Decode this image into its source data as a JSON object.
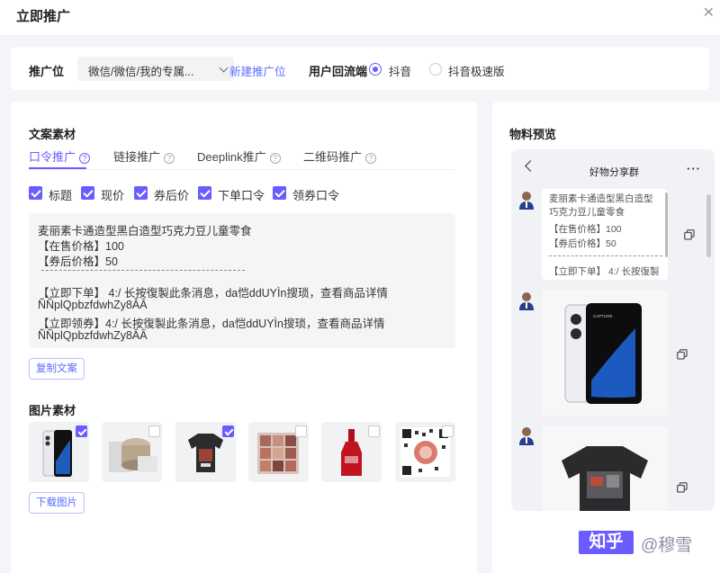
{
  "header": {
    "title": "立即推广",
    "close_icon": "close-icon"
  },
  "promo": {
    "label": "推广位",
    "select_value": "微信/微信/我的专属...",
    "new_link": "新建推广位",
    "return_label": "用户回流端",
    "options": [
      {
        "label": "抖音",
        "selected": true
      },
      {
        "label": "抖音极速版",
        "selected": false
      }
    ]
  },
  "copy": {
    "section_title": "文案素材",
    "tabs": [
      {
        "label": "口令推广",
        "active": true
      },
      {
        "label": "链接推广",
        "active": false
      },
      {
        "label": "Deeplink推广",
        "active": false
      },
      {
        "label": "二维码推广",
        "active": false
      }
    ],
    "checkboxes": [
      {
        "label": "标题",
        "checked": true
      },
      {
        "label": "现价",
        "checked": true
      },
      {
        "label": "券后价",
        "checked": true
      },
      {
        "label": "下单口令",
        "checked": true
      },
      {
        "label": "领券口令",
        "checked": true
      }
    ],
    "lines": [
      "麦丽素卡通造型黑白造型巧克力豆儿童零食",
      "【在售价格】100",
      "【券后价格】50",
      "【立即下单】 4:/ 长按復製此条消息，da恺ddUYÌn搜琐，查看商品详情",
      "ÑÑplQpbzfdwhZy8ÂÂ",
      "【立即领券】4:/ 长按復製此条消息，da恺ddUYÌn搜琐，查看商品详情",
      "ÑÑplQpbzfdwhZy8ÂÂ"
    ],
    "copy_button": "复制文案"
  },
  "images": {
    "section_title": "图片素材",
    "items": [
      {
        "name": "smartphone",
        "checked": true
      },
      {
        "name": "cosmetic-jar",
        "checked": false
      },
      {
        "name": "t-shirt",
        "checked": true
      },
      {
        "name": "eyeshadow-palette",
        "checked": false
      },
      {
        "name": "red-bottle",
        "checked": false
      },
      {
        "name": "qr-code",
        "checked": false
      }
    ],
    "download_button": "下载图片"
  },
  "preview": {
    "section_title": "物料预览",
    "chat_title": "好物分享群",
    "bubble_lines": [
      "麦丽素卡通造型黑白造型巧克力豆儿童零食",
      "【在售价格】100",
      "【券后价格】50",
      "【立即下单】 4:/ 长按復製"
    ]
  },
  "watermark": {
    "brand": "知乎",
    "user": "@穆雪"
  },
  "colors": {
    "accent": "#6a5cff",
    "link": "#5b6cff",
    "panel": "#ffffff",
    "background": "#f4f5f9"
  }
}
